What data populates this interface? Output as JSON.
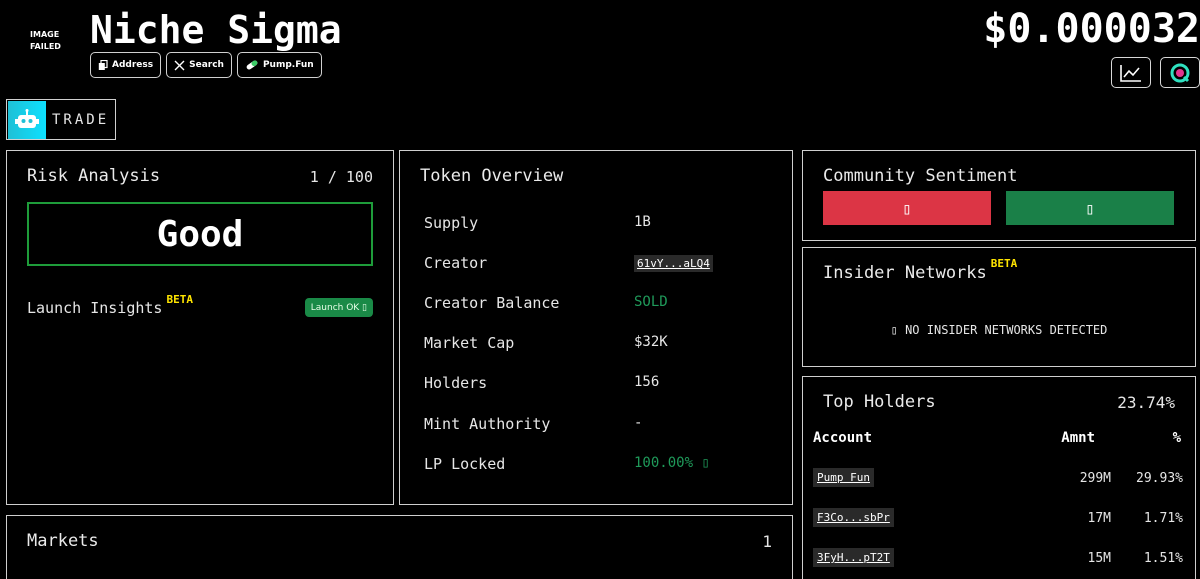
{
  "header": {
    "image_failed": "IMAGE FAILED",
    "token_name": "Niche Sigma",
    "price": "$0.000032",
    "pills": [
      {
        "label": "Address",
        "icon": "copy-icon"
      },
      {
        "label": "Search",
        "icon": "x-logo-icon"
      },
      {
        "label": "Pump.Fun",
        "icon": "pill-icon"
      }
    ]
  },
  "trade": {
    "label": "TRADE"
  },
  "risk": {
    "title": "Risk Analysis",
    "score": "1 / 100",
    "rating": "Good",
    "launch_label": "Launch Insights",
    "beta": "BETA",
    "launch_badge": "Launch OK ▯"
  },
  "overview": {
    "title": "Token Overview",
    "rows": [
      {
        "label": "Supply",
        "value": "1B"
      },
      {
        "label": "Creator",
        "value": "61vY...aLQ4"
      },
      {
        "label": "Creator Balance",
        "value": "SOLD"
      },
      {
        "label": "Market Cap",
        "value": "$32K"
      },
      {
        "label": "Holders",
        "value": "156"
      },
      {
        "label": "Mint Authority",
        "value": "-"
      },
      {
        "label": "LP Locked",
        "value": "100.00% ▯"
      }
    ]
  },
  "sentiment": {
    "title": "Community Sentiment",
    "down_glyph": "▯",
    "up_glyph": "▯"
  },
  "insider": {
    "title": "Insider Networks",
    "beta": "BETA",
    "message": "▯  NO INSIDER NETWORKS DETECTED"
  },
  "holders": {
    "title": "Top Holders",
    "total_pct": "23.74%",
    "columns": [
      "Account",
      "Amnt",
      "%"
    ],
    "rows": [
      {
        "account": "Pump Fun",
        "amount": "299M",
        "pct": "29.93%"
      },
      {
        "account": "F3Co...sbPr",
        "amount": "17M",
        "pct": "1.71%"
      },
      {
        "account": "3FyH...pT2T",
        "amount": "15M",
        "pct": "1.51%"
      }
    ]
  },
  "markets": {
    "title": "Markets",
    "count": "1"
  },
  "colors": {
    "good_border": "#1e9c3a",
    "green_text": "#1f9a5a",
    "vote_down": "#dc3545",
    "vote_up": "#1a8048",
    "beta": "#ffe500",
    "trade_accent": "#0de0ff"
  }
}
